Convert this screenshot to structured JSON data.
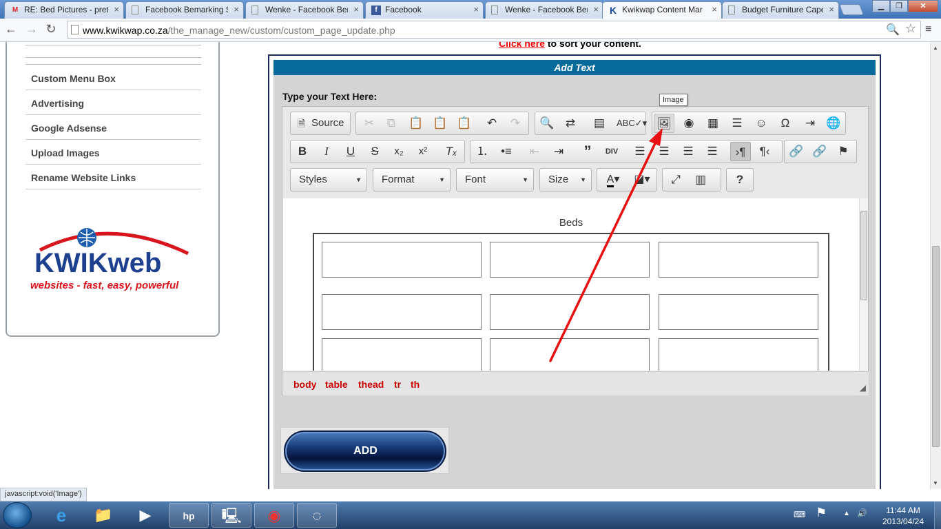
{
  "browser": {
    "tabs": [
      {
        "label": "RE: Bed Pictures - pretty",
        "icon": "gmail-icon"
      },
      {
        "label": "Facebook Bemarking S",
        "icon": "page-icon"
      },
      {
        "label": "Wenke - Facebook Ber",
        "icon": "page-icon"
      },
      {
        "label": "Facebook",
        "icon": "facebook-icon"
      },
      {
        "label": "Wenke - Facebook Ber",
        "icon": "page-icon"
      },
      {
        "label": "Kwikwap Content Mar",
        "icon": "kwikwap-icon"
      },
      {
        "label": "Budget Furniture Cape",
        "icon": "page-icon"
      }
    ],
    "url_host": "www.kwikwap.co.za",
    "url_path": "/the_manage_new/custom/custom_page_update.php",
    "status_text": "javascript:void('Image')"
  },
  "sidebar": {
    "items": [
      "Custom Menu Box",
      "Advertising",
      "Google Adsense",
      "Upload Images",
      "Rename Website Links"
    ],
    "logo_top": "KWIKweb",
    "logo_tagline": "websites - fast, easy, powerful"
  },
  "header": {
    "sort_link": "Click here",
    "sort_rest": " to sort your content."
  },
  "editor": {
    "section_title": "Add Text",
    "prompt": "Type your Text Here:",
    "source_label": "Source",
    "tooltip": "Image",
    "combos": {
      "styles": "Styles",
      "format": "Format",
      "font": "Font",
      "size": "Size"
    },
    "content_caption": "Beds",
    "path": [
      "body",
      "table",
      "thead",
      "tr",
      "th"
    ]
  },
  "actions": {
    "add_label": "ADD"
  },
  "taskbar": {
    "time": "11:44 AM",
    "date": "2013/04/24"
  },
  "colors": {
    "section_bar": "#066a9a",
    "path_text": "#cc0000",
    "annotation_arrow": "#e81010"
  }
}
